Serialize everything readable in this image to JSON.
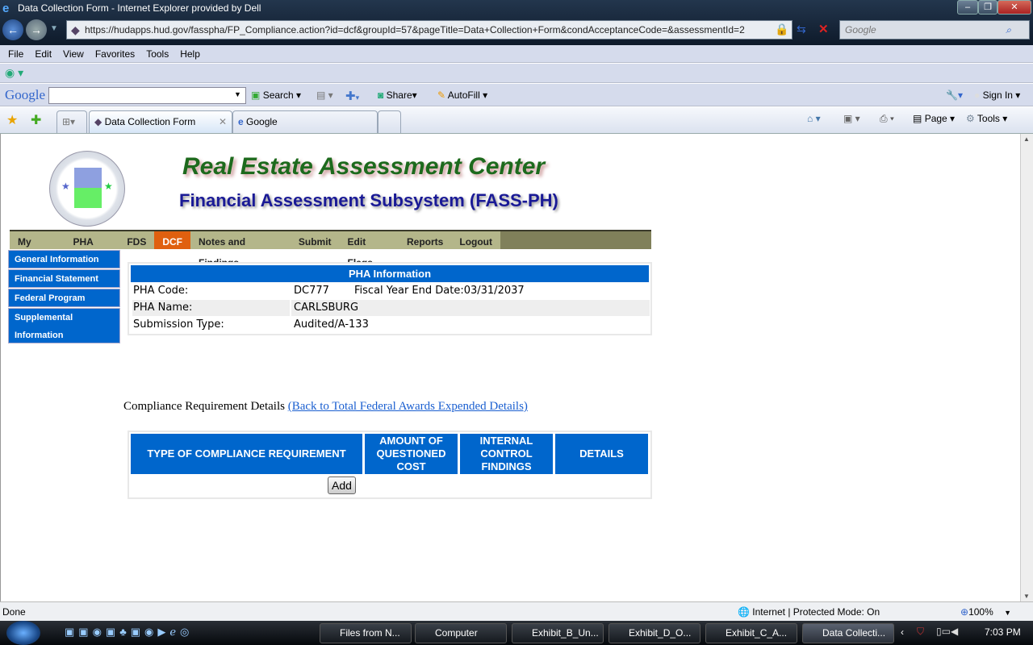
{
  "browser": {
    "title": "Data Collection Form - Internet Explorer provided by Dell",
    "url": "https://hudapps.hud.gov/fasspha/FP_Compliance.action?id=dcf&groupId=57&pageTitle=Data+Collection+Form&condAcceptanceCode=&assessmentId=2",
    "search_placeholder": "Google",
    "menu": [
      "File",
      "Edit",
      "View",
      "Favorites",
      "Tools",
      "Help"
    ],
    "google_toolbar": {
      "logo": "Google",
      "search": "Search",
      "share": "Share",
      "autofill": "AutoFill",
      "signin": "Sign In"
    },
    "tabs": [
      "Data Collection Form",
      "Google"
    ],
    "commands": {
      "page": "Page",
      "tools": "Tools"
    },
    "status": {
      "left": "Done",
      "zone": "Internet | Protected Mode: On",
      "zoom": "100%"
    }
  },
  "taskbar": {
    "items": [
      "Files from N...",
      "Computer",
      "Exhibit_B_Un...",
      "Exhibit_D_O...",
      "Exhibit_C_A...",
      "Data Collecti..."
    ],
    "clock": "7:03 PM"
  },
  "header": {
    "title": "Real Estate Assessment Center",
    "subtitle": "Financial Assessment Subsystem (FASS-PH)",
    "seal": "U.S. Department of Housing and Urban Development"
  },
  "nav": [
    "My Inbox",
    "PHA Info",
    "FDS",
    "DCF",
    "Notes and Findings",
    "Submit",
    "Edit Flags",
    "Reports",
    "Logout"
  ],
  "sidebar": [
    "General Information",
    "Financial Statement",
    "Federal Program",
    "Supplemental Information"
  ],
  "pha": {
    "heading": "PHA Information",
    "code_label": "PHA Code:",
    "code": "DC777",
    "fy_label": "Fiscal Year End Date:03/31/2037",
    "name_label": "PHA Name:",
    "name": "CARLSBURG",
    "type_label": "Submission Type:",
    "type": "Audited/A-133"
  },
  "compliance": {
    "label": "Compliance Requirement Details",
    "link": "(Back to Total Federal Awards Expended Details)",
    "columns": [
      "TYPE OF COMPLIANCE REQUIREMENT",
      "AMOUNT OF QUESTIONED COST",
      "INTERNAL CONTROL FINDINGS",
      "DETAILS"
    ],
    "add": "Add"
  }
}
